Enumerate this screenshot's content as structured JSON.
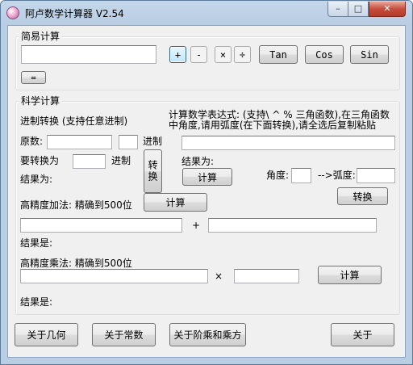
{
  "window": {
    "title": "阿卢数学计算器 V2.54",
    "minimize": "–",
    "maximize": "□",
    "close": "✕"
  },
  "simple": {
    "group_label": "简易计算",
    "input_value": "",
    "plus": "+",
    "minus": "-",
    "multiply": "×",
    "divide": "÷",
    "tan": "Tan",
    "cos": "Cos",
    "sin": "Sin",
    "equals": "="
  },
  "science": {
    "group_label": "科学计算",
    "base_title": "进制转换 (支持任意进制)",
    "source_label": "原数:",
    "source_value": "",
    "source_base_value": "",
    "base_suffix": "进制",
    "target_label": "要转换为",
    "target_base_value": "",
    "target_suffix": "进制",
    "convert_vertical": "转换",
    "base_result_label": "结果为:",
    "expr_desc": "计算数学表达式: (支持\\ ^ % 三角函数),在三角函数中角度,请用弧度(在下面转换),请全选后复制粘贴",
    "expr_value": "",
    "expr_result_label": "结果为:",
    "expr_calc": "计算",
    "angle_label": "角度:",
    "angle_value": "",
    "radian_label": "-->弧度:",
    "radian_value": "",
    "angle_convert": "转换",
    "add_title": "高精度加法: 精确到500位",
    "add_calc": "计算",
    "add_a": "",
    "add_op": "+",
    "add_b": "",
    "add_result_label": "结果是:",
    "mul_title": "高精度乘法: 精确到500位",
    "mul_a": "",
    "mul_op": "×",
    "mul_b": "",
    "mul_calc": "计算",
    "mul_result_label": "结果是:"
  },
  "footer": {
    "about_geometry": "关于几何",
    "about_constants": "关于常数",
    "about_factorial": "关于阶乘和乘方",
    "about": "关于"
  }
}
